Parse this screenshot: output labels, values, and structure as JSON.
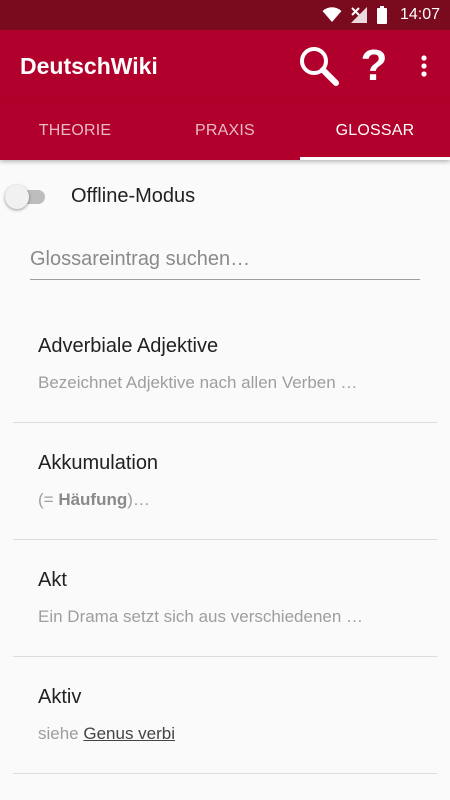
{
  "status_bar": {
    "time": "14:07",
    "icons": [
      "wifi-icon",
      "no-signal-icon",
      "battery-icon"
    ]
  },
  "app_bar": {
    "title": "DeutschWiki",
    "actions": [
      "search-icon",
      "help-icon",
      "more-vert-icon"
    ],
    "help_glyph": "?"
  },
  "tabs": [
    {
      "label": "THEORIE",
      "active": false
    },
    {
      "label": "PRAXIS",
      "active": false
    },
    {
      "label": "GLOSSAR",
      "active": true
    }
  ],
  "offline_toggle": {
    "label": "Offline-Modus",
    "on": false
  },
  "search": {
    "placeholder": "Glossareintrag suchen…",
    "value": ""
  },
  "entries": [
    {
      "title": "Adverbiale Adjektive",
      "desc": "Bezeichnet Adjektive nach allen Verben …"
    },
    {
      "title": "Akkumulation",
      "desc_prefix": "(= ",
      "desc_bold": "Häufung",
      "desc_suffix": ")…"
    },
    {
      "title": "Akt",
      "desc": "Ein Drama setzt sich aus verschiedenen …"
    },
    {
      "title": "Aktiv",
      "desc_prefix": "siehe ",
      "desc_link": "Genus verbi"
    }
  ],
  "colors": {
    "status_bar": "#7a0a1e",
    "primary": "#b0002b",
    "background": "#fafafa",
    "divider": "#dddddd"
  }
}
